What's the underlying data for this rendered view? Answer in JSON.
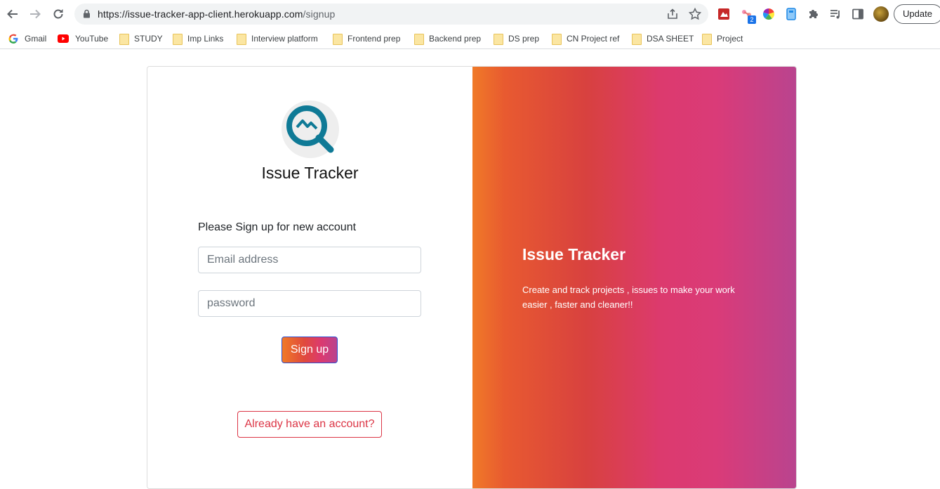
{
  "browser": {
    "url_host": "https://issue-tracker-app-client.herokuapp.com",
    "url_path": "/signup",
    "update_label": "Update",
    "extension_badge": "2"
  },
  "bookmarks": [
    {
      "label": "Gmail",
      "icon": "google-icon"
    },
    {
      "label": "YouTube",
      "icon": "youtube-icon"
    },
    {
      "label": "STUDY",
      "icon": "folder-icon"
    },
    {
      "label": "Imp Links",
      "icon": "folder-icon"
    },
    {
      "label": "Interview platform",
      "icon": "folder-icon"
    },
    {
      "label": "Frontend prep",
      "icon": "folder-icon"
    },
    {
      "label": "Backend prep",
      "icon": "folder-icon"
    },
    {
      "label": "DS prep",
      "icon": "folder-icon"
    },
    {
      "label": "CN Project ref",
      "icon": "folder-icon"
    },
    {
      "label": "DSA SHEET",
      "icon": "folder-icon"
    },
    {
      "label": "Project",
      "icon": "folder-icon"
    }
  ],
  "signup": {
    "brand": "Issue Tracker",
    "prompt": "Please Sign up for new account",
    "email_placeholder": "Email address",
    "password_placeholder": "password",
    "submit_label": "Sign up",
    "login_link_label": "Already have an account?"
  },
  "hero": {
    "title": "Issue Tracker",
    "description": "Create and track projects , issues to make your work easier , faster and cleaner!!"
  },
  "colors": {
    "logo_teal": "#0f7a96",
    "danger": "#dc3545",
    "gradient_start": "#f07a28",
    "gradient_mid": "#dc3a6e",
    "gradient_end": "#b9448f"
  }
}
